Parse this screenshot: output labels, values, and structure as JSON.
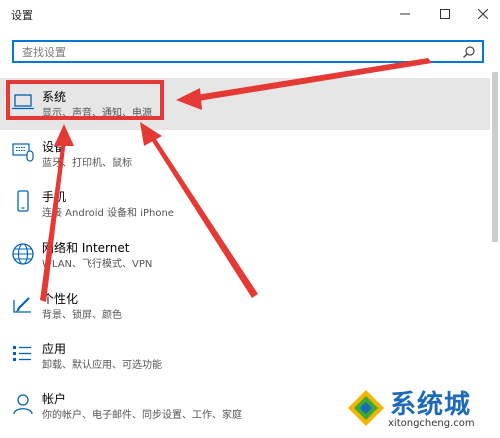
{
  "window": {
    "title": "设置",
    "controls": [
      "minimize",
      "maximize",
      "close"
    ]
  },
  "search": {
    "placeholder": "查找设置",
    "value": ""
  },
  "categories": [
    {
      "id": "system",
      "label": "系统",
      "desc": "显示、声音、通知、电源",
      "icon": "laptop-icon",
      "selected": true
    },
    {
      "id": "devices",
      "label": "设备",
      "desc": "蓝牙、打印机、鼠标",
      "icon": "keyboard-icon",
      "selected": false
    },
    {
      "id": "phone",
      "label": "手机",
      "desc": "连接 Android 设备和 iPhone",
      "icon": "phone-icon",
      "selected": false
    },
    {
      "id": "network",
      "label": "网络和 Internet",
      "desc": "WLAN、飞行模式、VPN",
      "icon": "globe-icon",
      "selected": false
    },
    {
      "id": "personalization",
      "label": "个性化",
      "desc": "背景、锁屏、颜色",
      "icon": "pen-on-screen-icon",
      "selected": false
    },
    {
      "id": "apps",
      "label": "应用",
      "desc": "卸载、默认应用、可选功能",
      "icon": "app-list-icon",
      "selected": false
    },
    {
      "id": "accounts",
      "label": "帐户",
      "desc": "你的帐户、电子邮件、同步设置、工作、家庭",
      "icon": "person-icon",
      "selected": false
    }
  ],
  "watermark": {
    "cn": "系统城",
    "en": "xitongcheng.com"
  },
  "colors": {
    "accent": "#0078d7",
    "selected_bg": "#e6e6e6",
    "annotation": "#e53935",
    "watermark": "#1c6bb8"
  }
}
